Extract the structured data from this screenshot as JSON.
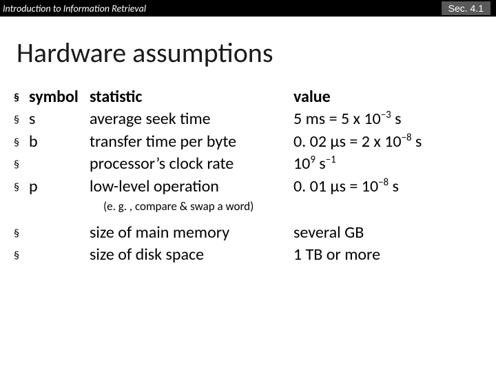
{
  "header": {
    "left": "Introduction to Information Retrieval",
    "right": "Sec. 4.1"
  },
  "title": "Hardware assumptions",
  "cols": {
    "symbol": "symbol",
    "statistic": "statistic",
    "value": "value"
  },
  "rows": [
    {
      "sym": "s",
      "stat": "average seek time",
      "val_html": "5 ms = 5 x 10<sup>−3</sup> s"
    },
    {
      "sym": "b",
      "stat": "transfer time per byte",
      "val_html": "0. 02 μs = 2 x 10<sup>−8</sup> s"
    },
    {
      "sym": "",
      "stat": "processor’s clock rate",
      "val_html": "10<sup>9</sup> s<sup>−1</sup>"
    },
    {
      "sym": "p",
      "stat": "low-level operation",
      "val_html": "0. 01 μs = 10<sup>−8</sup> s"
    }
  ],
  "note": "(e. g. , compare & swap a word)",
  "rows2": [
    {
      "sym": "",
      "stat": "size of main memory",
      "val": "several GB"
    },
    {
      "sym": "",
      "stat": "size of disk space",
      "val": "1 TB or more"
    }
  ],
  "bullet": "§"
}
